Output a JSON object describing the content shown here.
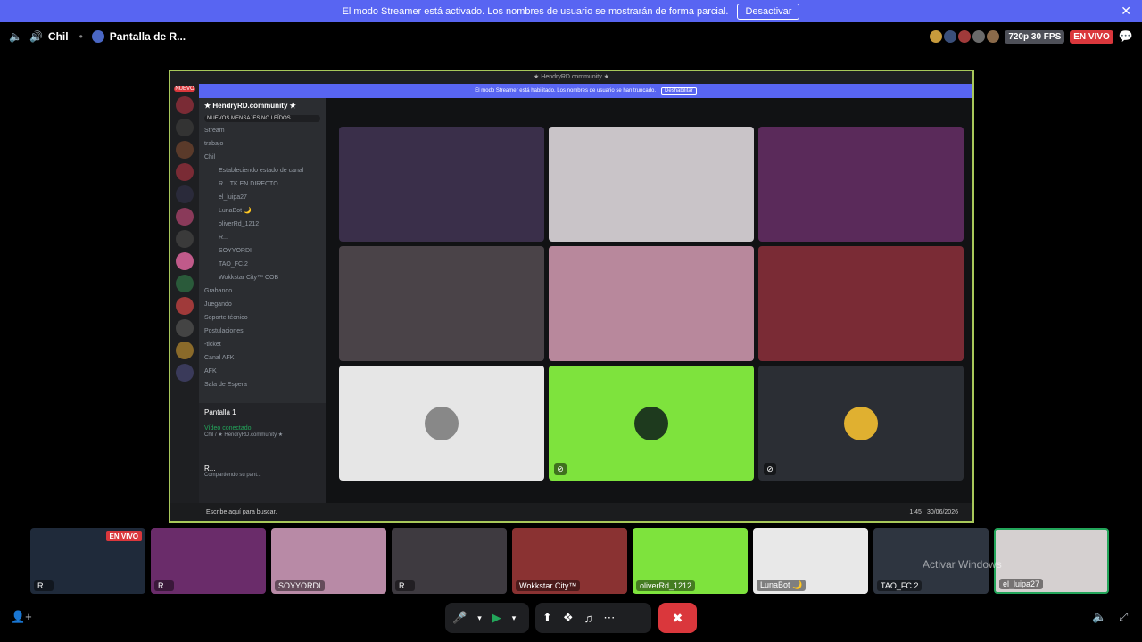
{
  "banner": {
    "text": "El modo Streamer está activado. Los nombres de usuario se mostrarán de forma parcial.",
    "button": "Desactivar"
  },
  "topbar": {
    "channel": "Chil",
    "screen": "Pantalla de R...",
    "quality": "720p 30 FPS",
    "live": "EN VIVO"
  },
  "stage": {
    "window_title": "★ HendryRD.community ★",
    "inner_banner": "El modo Streamer está habilitado. Los nombres de usuario se han truncado.",
    "inner_banner_button": "Deshabilitar",
    "server_name": "★ HendryRD.community ★",
    "new_label": "NUEVO",
    "unread_label": "NUEVOS MENSAJES NO LEÍDOS",
    "channels": [
      {
        "label": "Stream",
        "sub": false
      },
      {
        "label": "trabajo",
        "sub": false
      },
      {
        "label": "Chil",
        "sub": false
      },
      {
        "label": "Estableciendo estado de canal",
        "sub": true
      },
      {
        "label": "R...   TK   EN DIRECTO",
        "sub": true
      },
      {
        "label": "el_luipa27",
        "sub": true
      },
      {
        "label": "LunaBot 🌙",
        "sub": true
      },
      {
        "label": "oliverRd_1212",
        "sub": true
      },
      {
        "label": "R...",
        "sub": true
      },
      {
        "label": "SOYYORDI",
        "sub": true
      },
      {
        "label": "TAO_FC.2",
        "sub": true
      },
      {
        "label": "Wokkstar City™  COB",
        "sub": true
      },
      {
        "label": "Grabando",
        "sub": false
      },
      {
        "label": "Juegando",
        "sub": false
      },
      {
        "label": "Soporte técnico",
        "sub": false
      },
      {
        "label": "Postulaciones",
        "sub": false
      },
      {
        "label": "-ticket",
        "sub": false
      },
      {
        "label": "Canal AFK",
        "sub": false
      },
      {
        "label": "AFK",
        "sub": false
      },
      {
        "label": "Sala de Espera",
        "sub": false
      }
    ],
    "voice_panel_title": "Pantalla 1",
    "voice_status": "Vídeo conectado",
    "voice_channel": "Chil / ★ HendryRD.community ★",
    "user_name": "R...",
    "user_status": "Compartiendo su pant...",
    "search_placeholder": "Escribe aquí para buscar.",
    "clock": "1:45",
    "date": "30/06/2026"
  },
  "grid_colors": [
    "#3a2f4a",
    "#c9c4c8",
    "#5a2a5a",
    "#4a4348",
    "#b8889c",
    "#7a2b35",
    "#e6e6e6",
    "#7ee33d",
    "#2b2e34"
  ],
  "thumbnails": [
    {
      "label": "R...",
      "live": "EN VIVO",
      "color": "#1f2a3a"
    },
    {
      "label": "R...",
      "live": "",
      "color": "#6a2c6a"
    },
    {
      "label": "SOYYORDI",
      "live": "",
      "color": "#b88aa6"
    },
    {
      "label": "R...",
      "live": "",
      "color": "#3e3a40"
    },
    {
      "label": "Wokkstar City™",
      "live": "",
      "color": "#8a3232"
    },
    {
      "label": "oliverRd_1212",
      "live": "",
      "color": "#7ee33d"
    },
    {
      "label": "LunaBot 🌙",
      "live": "",
      "color": "#e8e8e8"
    },
    {
      "label": "TAO_FC.2",
      "live": "",
      "color": "#2e3540"
    },
    {
      "label": "el_luipa27",
      "live": "",
      "color": "#d5d0d0"
    }
  ],
  "watermark": "Activar Windows"
}
